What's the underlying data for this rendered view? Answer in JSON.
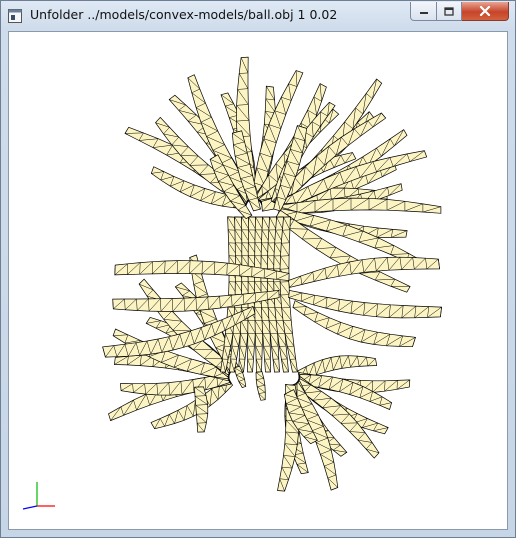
{
  "window": {
    "title": "Unfolder ../models/convex-models/ball.obj 1 0.02"
  },
  "caption_buttons": {
    "minimize_icon": "minimize-icon",
    "maximize_icon": "maximize-icon",
    "close_icon": "close-icon"
  },
  "viewport": {
    "background": "#ffffff",
    "mesh_fill": "#fcf5c3",
    "mesh_stroke": "#000000",
    "axis_colors": {
      "x": "#ff0000",
      "y": "#00bb00",
      "z": "#0000ff"
    }
  }
}
